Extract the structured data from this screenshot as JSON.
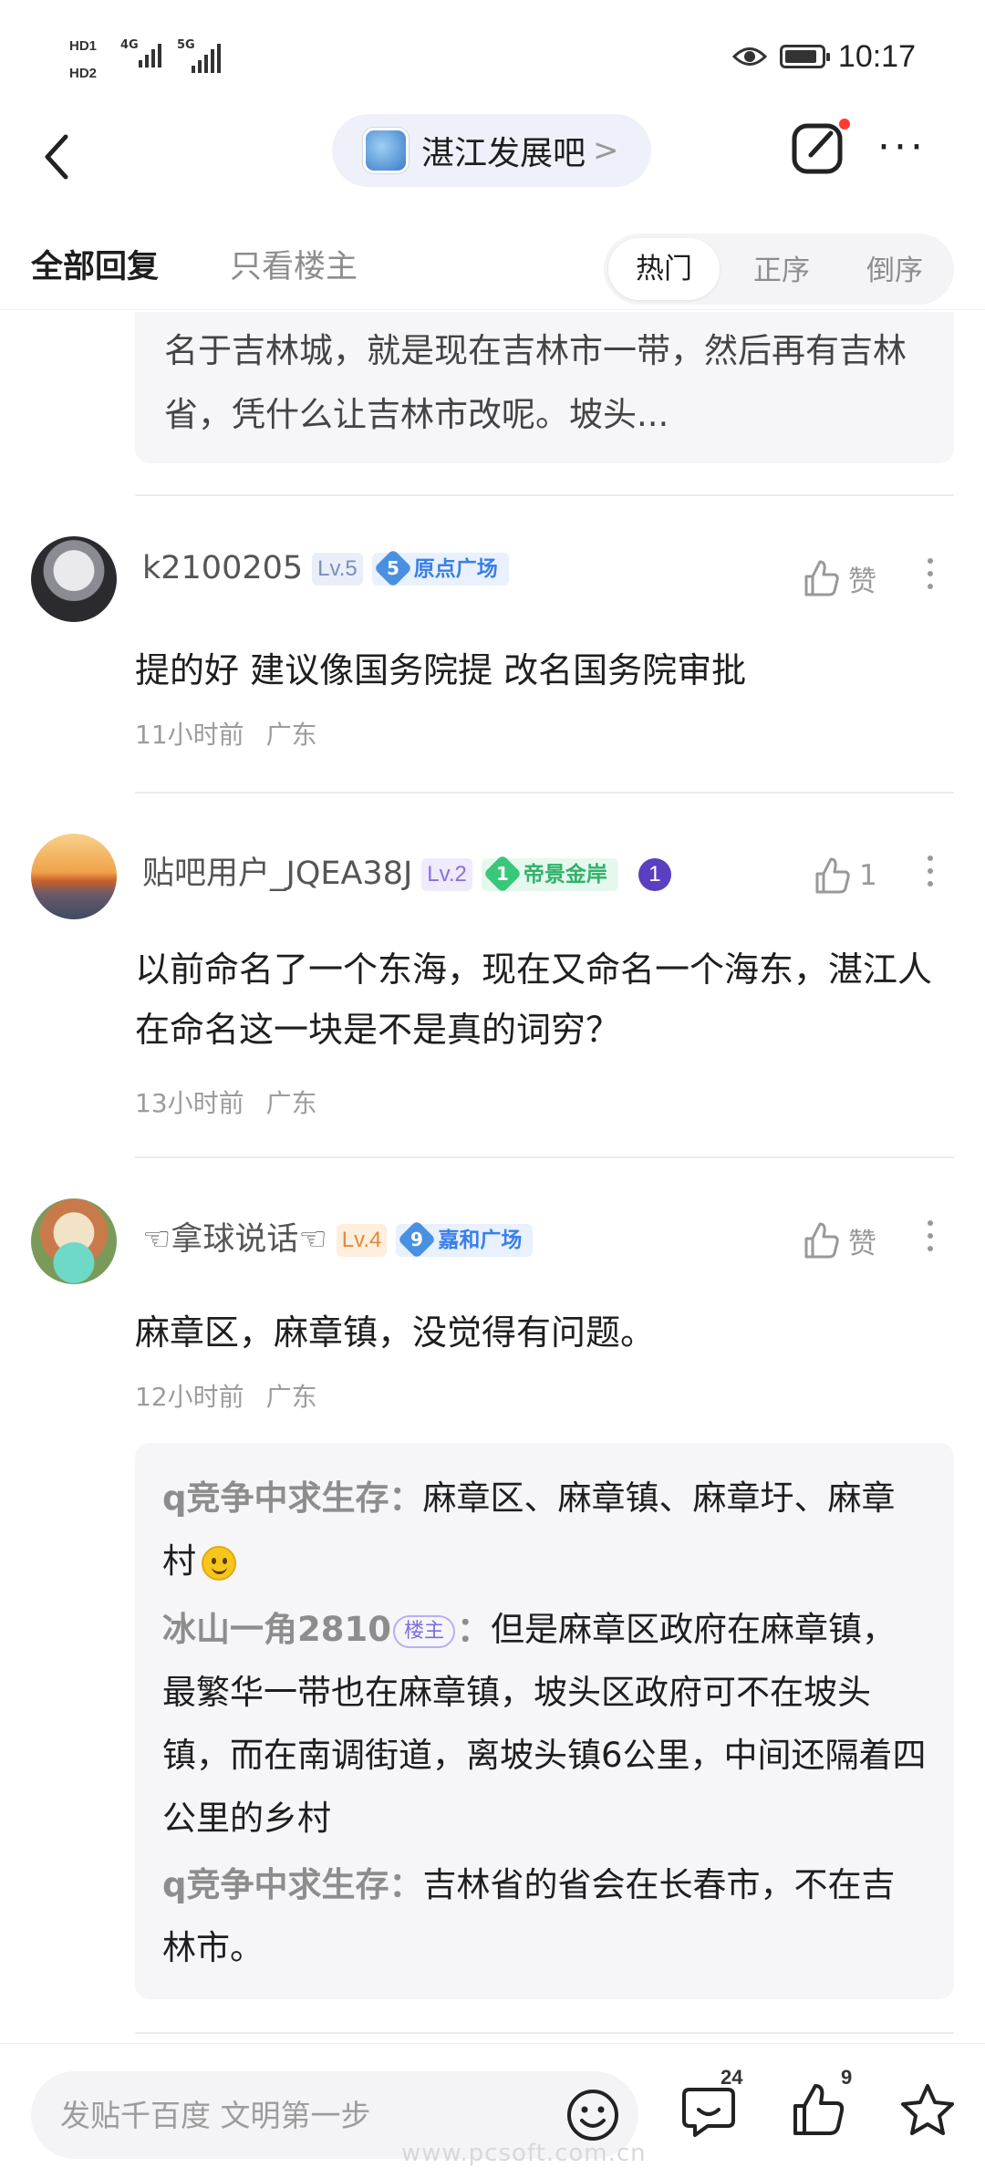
{
  "status_bar": {
    "time": "10:17",
    "hd1": "HD1",
    "hd2": "HD2",
    "net1": "4G",
    "net2": "5G"
  },
  "header": {
    "forum_name": "湛江发展吧",
    "forum_chevron": ">",
    "more": "···"
  },
  "tabs": {
    "all_replies": "全部回复",
    "only_op": "只看楼主",
    "sort": [
      "热门",
      "正序",
      "倒序"
    ]
  },
  "quote_top": {
    "text": "名于吉林城，就是现在吉林市一带，然后再有吉林省，凭什么让吉林市改呢。坡头..."
  },
  "posts": [
    {
      "username": "k2100205",
      "level": "Lv.5",
      "tag_num": "5",
      "tag_name": "原点广场",
      "like": "赞",
      "content": "提的好 建议像国务院提 改名国务院审批",
      "time": "11小时前",
      "location": "广东"
    },
    {
      "username": "贴吧用户_JQEA38J",
      "level": "Lv.2",
      "tag_num": "1",
      "tag_name": "帝景金岸",
      "extra_badge": "1",
      "like": "1",
      "content": "以前命名了一个东海，现在又命名一个海东，湛江人在命名这一块是不是真的词穷？",
      "time": "13小时前",
      "location": "广东"
    },
    {
      "username": "☜拿球说话☜",
      "level": "Lv.4",
      "tag_num": "9",
      "tag_name": "嘉和广场",
      "like": "赞",
      "content": "麻章区，麻章镇，没觉得有问题。",
      "time": "12小时前",
      "location": "广东"
    }
  ],
  "replies": [
    {
      "name": "q竞争中求生存",
      "sep": "：",
      "text": "麻章区、麻章镇、麻章圩、麻章村"
    },
    {
      "name": "冰山一角2810",
      "badge": "楼主",
      "sep": "：",
      "text": "但是麻章区政府在麻章镇，最繁华一带也在麻章镇，坡头区政府可不在坡头镇，而在南调街道，离坡头镇6公里，中间还隔着四公里的乡村"
    },
    {
      "name": "q竞争中求生存",
      "sep": "：",
      "text": "吉林省的省会在长春市，不在吉林市。"
    }
  ],
  "bottom_bar": {
    "input_placeholder": "发贴千百度 文明第一步",
    "comment_count": "24",
    "like_count": "9"
  },
  "watermark": "www.pcsoft.com.cn"
}
